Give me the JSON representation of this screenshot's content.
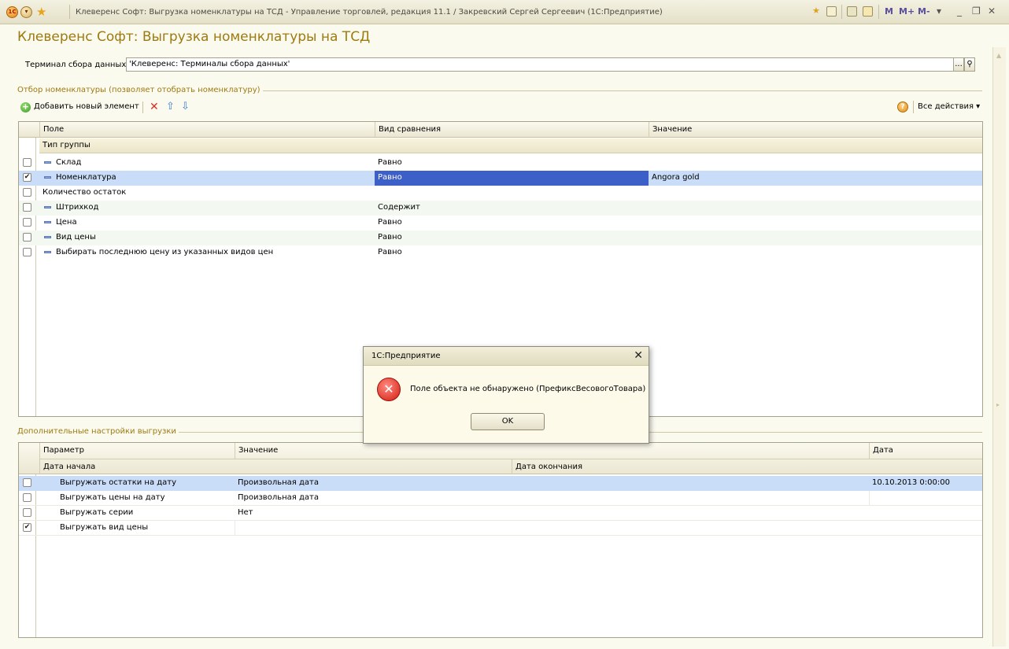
{
  "window": {
    "title": "Клеверенс Софт: Выгрузка номенклатуры на ТСД - Управление торговлей, редакция 11.1 / Закревский Сергей Сергеевич  (1С:Предприятие)",
    "logo_text": "1С",
    "calc_labels": [
      "M",
      "M+",
      "M-"
    ]
  },
  "form": {
    "title": "Клеверенс Софт: Выгрузка номенклатуры на ТСД",
    "terminal_label": "Терминал сбора данных:",
    "terminal_value": "'Клеверенс: Терминалы сбора данных'",
    "terminal_select_btn": "...",
    "filter_group_title": "Отбор номенклатуры (позволяет отобрать номенклатуру)",
    "toolbar": {
      "add_label": "Добавить новый элемент",
      "all_actions": "Все действия ▾",
      "help": "?"
    },
    "filter_grid": {
      "headers": [
        "Поле",
        "Вид сравнения",
        "Значение"
      ],
      "group_row": "Тип группы",
      "rows": [
        {
          "checked": false,
          "field": "Склад",
          "comparison": "Равно",
          "value": "",
          "dash": true
        },
        {
          "checked": true,
          "field": "Номенклатура",
          "comparison": "Равно",
          "value": "Angora gold",
          "dash": true
        },
        {
          "checked": false,
          "field": "Количество остаток",
          "comparison": "",
          "value": "",
          "dash": false
        },
        {
          "checked": false,
          "field": "Штрихкод",
          "comparison": "Содержит",
          "value": "",
          "dash": true
        },
        {
          "checked": false,
          "field": "Цена",
          "comparison": "Равно",
          "value": "",
          "dash": true
        },
        {
          "checked": false,
          "field": "Вид цены",
          "comparison": "Равно",
          "value": "",
          "dash": true
        },
        {
          "checked": false,
          "field": "Выбирать последнюю цену из указанных видов цен",
          "comparison": "Равно",
          "value": "",
          "dash": true
        }
      ]
    },
    "extra_group_title": "Дополнительные настройки выгрузки",
    "extra_grid": {
      "headers": [
        "Параметр",
        "Значение",
        "Дата"
      ],
      "subheaders": [
        "Дата начала",
        "Дата окончания"
      ],
      "rows": [
        {
          "checked": false,
          "param": "Выгружать остатки на дату",
          "value": "Произвольная дата",
          "date": "10.10.2013 0:00:00"
        },
        {
          "checked": false,
          "param": "Выгружать цены на дату",
          "value": "Произвольная дата",
          "date": ""
        },
        {
          "checked": false,
          "param": "Выгружать серии",
          "value": "Нет",
          "date": ""
        },
        {
          "checked": true,
          "param": "Выгружать вид цены",
          "value": "",
          "date": ""
        }
      ]
    }
  },
  "dialog": {
    "title": "1С:Предприятие",
    "message": "Поле объекта не обнаружено (ПрефиксВесовогоТовара)",
    "ok_label": "OK"
  },
  "colors": {
    "accent_title": "#9e7a10",
    "selection": "#c9dcf8",
    "selection_dark": "#3d5fc8"
  }
}
